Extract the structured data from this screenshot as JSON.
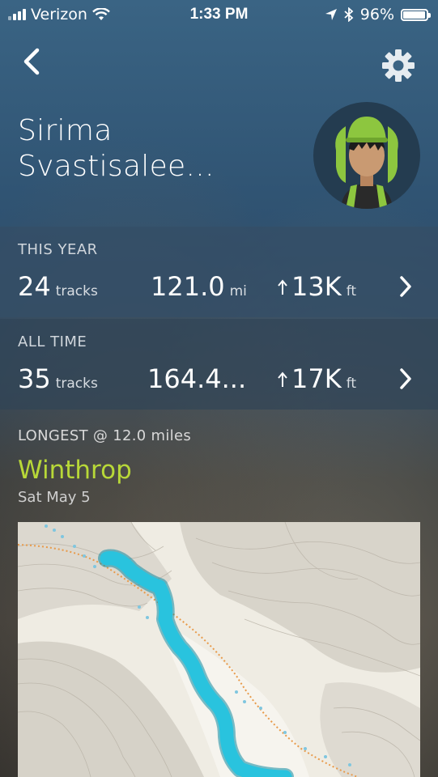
{
  "status_bar": {
    "carrier": "Verizon",
    "time": "1:33 PM",
    "battery": "96%",
    "battery_level": 0.96
  },
  "profile": {
    "name_line1": "Sirima",
    "name_line2": "Svastisalee..."
  },
  "this_year": {
    "label": "THIS YEAR",
    "tracks": "24",
    "tracks_unit": "tracks",
    "distance": "121.0",
    "distance_unit": "mi",
    "elevation": "13K",
    "elevation_unit": "ft"
  },
  "all_time": {
    "label": "ALL TIME",
    "tracks": "35",
    "tracks_unit": "tracks",
    "distance": "164.4...",
    "elevation": "17K",
    "elevation_unit": "ft"
  },
  "longest": {
    "label": "LONGEST @ 12.0 miles",
    "name": "Winthrop",
    "date": "Sat May 5"
  },
  "icons": [
    "back-chevron-icon",
    "gear-icon",
    "chevron-right-icon",
    "elevation-up-arrow-icon",
    "wifi-icon",
    "location-arrow-icon",
    "bluetooth-icon"
  ],
  "colors": {
    "accent_green": "#b8d838",
    "track_blue": "#29c3de",
    "header_blue": "#3a6484"
  }
}
